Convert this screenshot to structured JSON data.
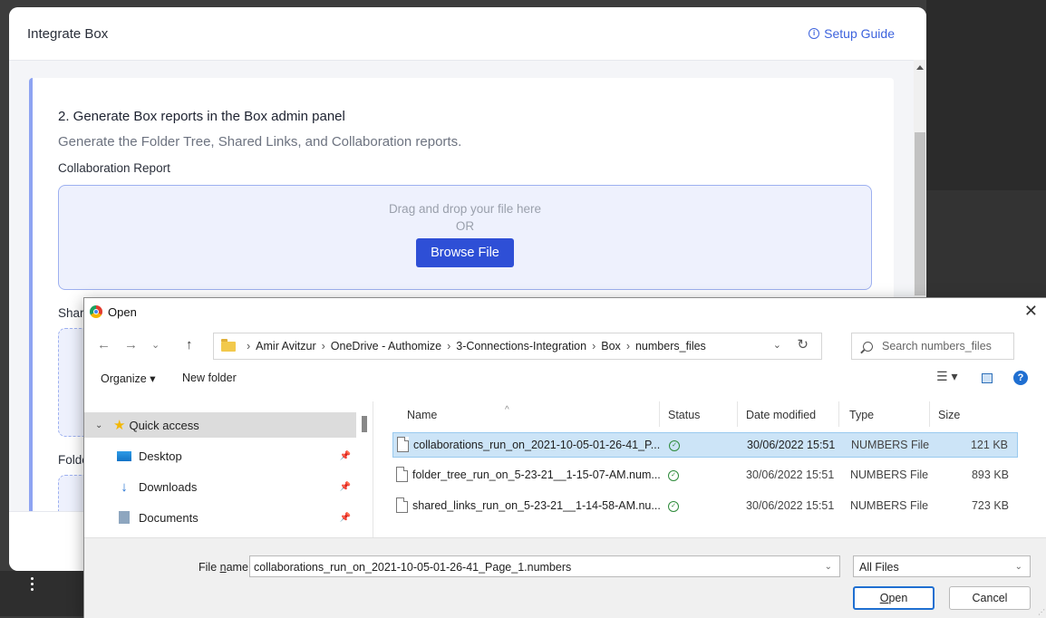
{
  "app": {
    "title": "Integrate Box",
    "setup_guide": "Setup Guide",
    "step_title": "2. Generate Box reports in the Box admin panel",
    "step_desc": "Generate the Folder Tree, Shared Links, and Collaboration reports.",
    "collab_label": "Collaboration Report",
    "dropzone": {
      "text": "Drag and drop your file here",
      "or": "OR",
      "button": "Browse File"
    },
    "shared_label_partial": "Shar",
    "folder_label_partial": "Folde"
  },
  "dialog": {
    "title": "Open",
    "close": "✕",
    "nav": {
      "back": "←",
      "forward": "→",
      "recent": "⌄",
      "up": "↑"
    },
    "address": [
      "Amir Avitzur",
      "OneDrive - Authomize",
      "3-Connections-Integration",
      "Box",
      "numbers_files"
    ],
    "address_sep": "›",
    "search_placeholder": "Search numbers_files",
    "toolbar": {
      "organize": "Organize ▾",
      "new_folder": "New folder"
    },
    "sidebar": [
      {
        "label": "Quick access",
        "chevron": "⌄"
      },
      {
        "label": "Desktop"
      },
      {
        "label": "Downloads"
      },
      {
        "label": "Documents"
      }
    ],
    "columns": [
      "Name",
      "Status",
      "Date modified",
      "Type",
      "Size"
    ],
    "files": [
      {
        "name": "collaborations_run_on_2021-10-05-01-26-41_P...",
        "status": "✓",
        "date": "30/06/2022 15:51",
        "type": "NUMBERS File",
        "size": "121 KB"
      },
      {
        "name": "folder_tree_run_on_5-23-21__1-15-07-AM.num...",
        "status": "✓",
        "date": "30/06/2022 15:51",
        "type": "NUMBERS File",
        "size": "893 KB"
      },
      {
        "name": "shared_links_run_on_5-23-21__1-14-58-AM.nu...",
        "status": "✓",
        "date": "30/06/2022 15:51",
        "type": "NUMBERS File",
        "size": "723 KB"
      }
    ],
    "file_name_label_pre": "File ",
    "file_name_label_u": "n",
    "file_name_label_post": "ame:",
    "file_name_value": "collaborations_run_on_2021-10-05-01-26-41_Page_1.numbers",
    "filter": "All Files",
    "open_button_u": "O",
    "open_button_rest": "pen",
    "cancel_button": "Cancel"
  }
}
